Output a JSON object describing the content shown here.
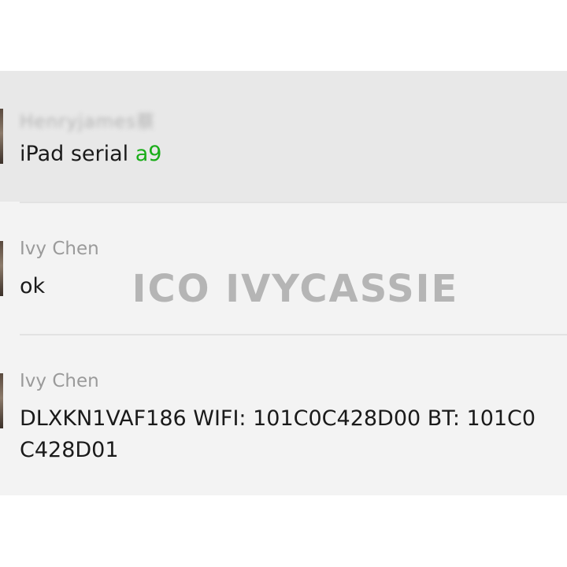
{
  "messages": [
    {
      "sender": "Henryjames蔡",
      "text": "iPad serial ",
      "accent_text": "a9"
    },
    {
      "sender": "Ivy Chen",
      "text": "ok"
    },
    {
      "sender": "Ivy Chen",
      "line1": "DLXKN1VAF186 WIFI: 101C0C428D00 BT: 101C0",
      "line2": "C428D01"
    }
  ],
  "watermark": "ICO IVYCASSIE",
  "colors": {
    "accent": "#1aad19",
    "panel": "#f3f3f3",
    "highlight": "#e8e8e8",
    "sender": "#9a9a9a",
    "text": "#1a1a1a"
  }
}
